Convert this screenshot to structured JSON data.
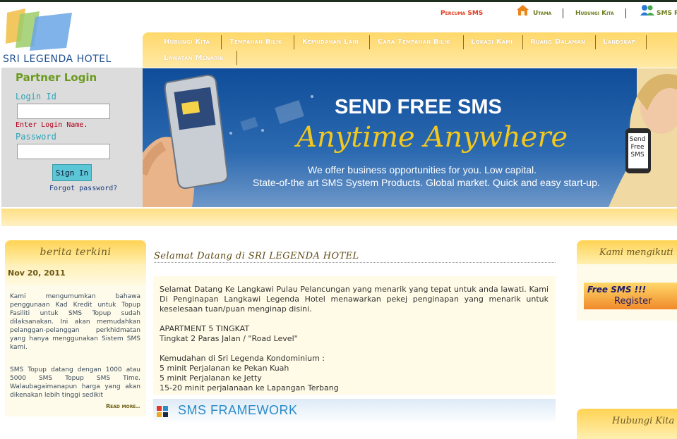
{
  "site": {
    "title": "SRI LEGENDA HOTEL"
  },
  "top_links": {
    "sms": "Percuma SMS",
    "utama": "Utama",
    "hubungi": "Hubungi Kita",
    "sms_partner": "SMS P"
  },
  "nav": {
    "items": [
      "Hubungi Kita",
      "Tempahan Bilik",
      "Kemudahan Lain",
      "Cara Tempahan Bilik",
      "Lokasi Kami",
      "Ruang Dalaman",
      "Landskap",
      "Lawatan Menarik"
    ]
  },
  "login": {
    "title": "Partner Login",
    "login_label": "Login Id",
    "login_value": "",
    "hint": "Enter Login Name.",
    "password_label": "Password",
    "password_value": "",
    "signin": "Sign In",
    "forgot": "Forgot password?"
  },
  "banner": {
    "title": "SEND FREE SMS",
    "subtitle": "Anytime  Anywhere",
    "line1": "We offer business opportunities for you. Low capital.",
    "line2": "State-of-the art SMS System Products. Global market. Quick and easy start-up.",
    "phone_text": [
      "Send",
      "Free",
      "SMS"
    ]
  },
  "news": {
    "header": "berita terkini",
    "date": "Nov 20, 2011",
    "p1": "Kami mengumumkan bahawa penggunaan Kad Kredit untuk Topup Fasiliti untuk SMS Topup sudah dilaksanakan. Ini akan memudahkan pelanggan-pelanggan perkhidmatan yang hanya menggunakan Sistem SMS kami.",
    "p2": "SMS Topup datang dengan 1000 atau 5000 SMS Topup SMS Time. Walaubagaimanapun harga yang akan dikenakan lebih tinggi sedikit",
    "read_more": "Read more.."
  },
  "main": {
    "heading": "Selamat Datang di SRI LEGENDA HOTEL",
    "p1": "Selamat Datang Ke Langkawi Pulau Pelancungan yang menarik yang tepat untuk anda lawati. Kami Di Penginapan Langkawi Legenda Hotel menawarkan pekej penginapan yang menarik untuk keselesaan tuan/puan menginap disini.",
    "apt1": "APARTMENT 5 TINGKAT",
    "apt2": "Tingkat 2 Paras Jalan / \"Road Level\"",
    "kemudahan": "Kemudahan di Sri Legenda Kondominium :",
    "k1": "5 minit Perjalanan ke Pekan Kuah",
    "k2": "5 minit Perjalanan ke Jetty",
    "k3": "15-20 minit perjalanaan ke Lapangan Terbang",
    "framework": "SMS FRAMEWORK"
  },
  "right": {
    "box1_title": "Kami mengikuti",
    "freesms_l1": "Free SMS !!!",
    "freesms_l2": "Register",
    "box2_title": "Hubungi Kita"
  }
}
